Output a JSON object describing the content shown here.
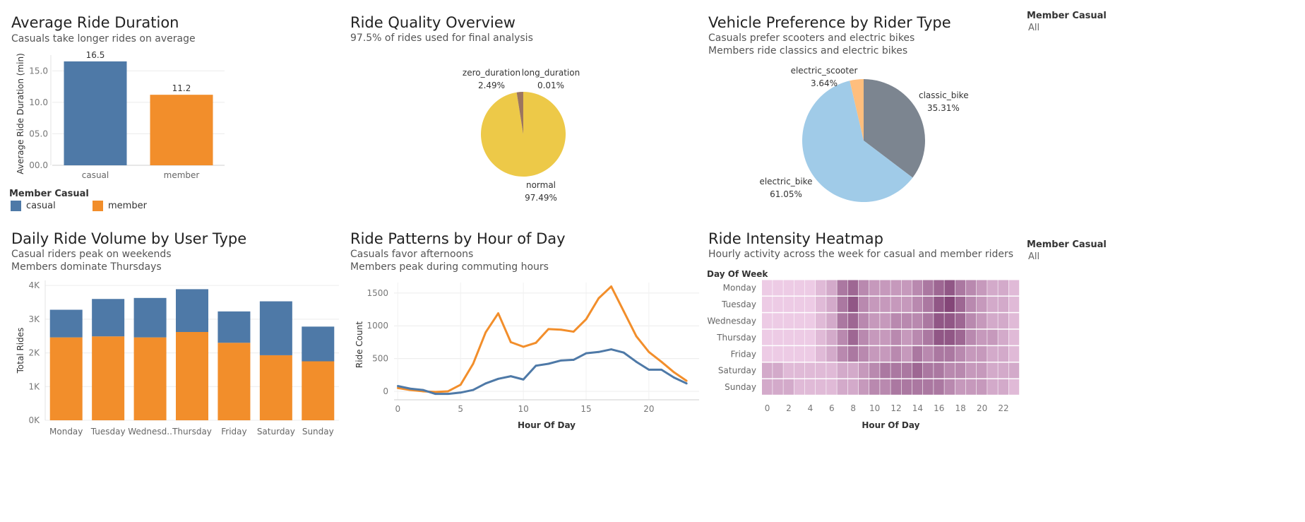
{
  "filters": [
    {
      "title": "Member Casual",
      "value": "All"
    },
    {
      "title": "Member Casual",
      "value": "All"
    }
  ],
  "panels": {
    "avg_duration": {
      "title": "Average Ride Duration",
      "subtitle": "Casuals take longer rides on average"
    },
    "ride_quality": {
      "title": "Ride Quality Overview",
      "subtitle": "97.5% of rides used for final analysis"
    },
    "vehicle_pref": {
      "title": "Vehicle Preference by Rider Type",
      "subtitle_1": "Casuals prefer scooters and electric bikes",
      "subtitle_2": "Members ride classics and electric bikes"
    },
    "daily_volume": {
      "title": "Daily Ride Volume by User Type",
      "subtitle_1": "Casual riders peak on weekends",
      "subtitle_2": "Members dominate Thursdays"
    },
    "hourly": {
      "title": "Ride Patterns by Hour of Day",
      "subtitle_1": "Casuals favor afternoons",
      "subtitle_2": "Members peak during commuting hours"
    },
    "heatmap": {
      "title": "Ride Intensity Heatmap",
      "subtitle": "Hourly activity across the week for casual and member riders"
    }
  },
  "legend": {
    "title": "Member Casual",
    "items": [
      {
        "label": "casual",
        "color": "#4e79a7"
      },
      {
        "label": "member",
        "color": "#f28e2b"
      }
    ]
  },
  "colors": {
    "casual": "#4e79a7",
    "member": "#f28e2b"
  },
  "chart_data": [
    {
      "id": "avg_duration",
      "type": "bar",
      "categories": [
        "casual",
        "member"
      ],
      "values": [
        16.5,
        11.2
      ],
      "value_labels": [
        "16.5",
        "11.2"
      ],
      "ylabel": "Average Ride Duration (min)",
      "yticks": [
        0,
        5,
        10,
        15
      ],
      "ytick_labels": [
        "00.0",
        "05.0",
        "10.0",
        "15.0"
      ],
      "ylim": [
        0,
        17.5
      ],
      "colors": [
        "#4e79a7",
        "#f28e2b"
      ]
    },
    {
      "id": "ride_quality",
      "type": "pie",
      "slices": [
        {
          "label": "normal",
          "pct_label": "97.49%",
          "value": 97.49,
          "color": "#edc948"
        },
        {
          "label": "zero_duration",
          "pct_label": "2.49%",
          "value": 2.49,
          "color": "#9c755f"
        },
        {
          "label": "long_duration",
          "pct_label": "0.01%",
          "value": 0.01,
          "color": "#e15759"
        }
      ]
    },
    {
      "id": "vehicle_pref",
      "type": "pie",
      "slices": [
        {
          "label": "classic_bike",
          "pct_label": "35.31%",
          "value": 35.31,
          "color": "#7c8590"
        },
        {
          "label": "electric_bike",
          "pct_label": "61.05%",
          "value": 61.05,
          "color": "#a0cbe8"
        },
        {
          "label": "electric_scooter",
          "pct_label": "3.64%",
          "value": 3.64,
          "color": "#ffbe7d"
        }
      ]
    },
    {
      "id": "daily_volume",
      "type": "bar",
      "stacked": true,
      "categories": [
        "Monday",
        "Tuesday",
        "Wednesd..",
        "Thursday",
        "Friday",
        "Saturday",
        "Sunday"
      ],
      "series": [
        {
          "name": "member",
          "values": [
            2460,
            2490,
            2460,
            2620,
            2300,
            1930,
            1750
          ]
        },
        {
          "name": "casual",
          "values": [
            820,
            1110,
            1170,
            1270,
            930,
            1600,
            1030
          ]
        }
      ],
      "ylabel": "Total Rides",
      "yticks": [
        0,
        1000,
        2000,
        3000,
        4000
      ],
      "ytick_labels": [
        "0K",
        "1K",
        "2K",
        "3K",
        "4K"
      ],
      "ylim": [
        0,
        4150
      ]
    },
    {
      "id": "hourly",
      "type": "line",
      "x": [
        0,
        1,
        2,
        3,
        4,
        5,
        6,
        7,
        8,
        9,
        10,
        11,
        12,
        13,
        14,
        15,
        16,
        17,
        18,
        19,
        20,
        21,
        22,
        23
      ],
      "series": [
        {
          "name": "member",
          "values": [
            50,
            20,
            0,
            -10,
            0,
            100,
            420,
            900,
            1190,
            750,
            680,
            740,
            950,
            940,
            910,
            1100,
            1420,
            1600,
            1220,
            840,
            600,
            450,
            290,
            160
          ]
        },
        {
          "name": "casual",
          "values": [
            80,
            40,
            20,
            -40,
            -40,
            -20,
            20,
            120,
            190,
            230,
            180,
            390,
            420,
            470,
            480,
            580,
            600,
            640,
            590,
            450,
            330,
            330,
            210,
            120
          ]
        }
      ],
      "xlabel": "Hour Of Day",
      "ylabel": "Ride Count",
      "xticks": [
        0,
        5,
        10,
        15,
        20
      ],
      "yticks": [
        0,
        500,
        1000,
        1500
      ],
      "xlim": [
        -0.3,
        24
      ],
      "ylim": [
        -130,
        1660
      ]
    },
    {
      "id": "heatmap",
      "type": "heatmap",
      "row_header": "Day Of Week",
      "rows": [
        "Monday",
        "Tuesday",
        "Wednesday",
        "Thursday",
        "Friday",
        "Saturday",
        "Sunday"
      ],
      "columns": [
        0,
        1,
        2,
        3,
        4,
        5,
        6,
        7,
        8,
        9,
        10,
        11,
        12,
        13,
        14,
        15,
        16,
        17,
        18,
        19,
        20,
        21,
        22,
        23
      ],
      "xticks": [
        0,
        2,
        4,
        6,
        8,
        10,
        12,
        14,
        16,
        18,
        20,
        22
      ],
      "xlabel": "Hour Of Day",
      "values": [
        [
          1,
          1,
          1,
          1,
          1,
          2,
          3,
          6,
          7,
          5,
          4,
          4,
          4,
          4,
          5,
          6,
          7,
          8,
          6,
          5,
          4,
          3,
          3,
          2
        ],
        [
          1,
          1,
          1,
          1,
          1,
          2,
          3,
          6,
          8,
          5,
          4,
          4,
          4,
          4,
          5,
          6,
          8,
          9,
          7,
          5,
          4,
          3,
          3,
          2
        ],
        [
          1,
          1,
          1,
          1,
          1,
          2,
          3,
          6,
          7,
          5,
          4,
          4,
          5,
          5,
          5,
          6,
          8,
          8,
          7,
          5,
          4,
          3,
          3,
          2
        ],
        [
          1,
          1,
          1,
          1,
          1,
          2,
          3,
          5,
          7,
          5,
          4,
          4,
          5,
          4,
          5,
          6,
          8,
          8,
          7,
          5,
          4,
          4,
          3,
          2
        ],
        [
          1,
          1,
          1,
          1,
          1,
          2,
          3,
          5,
          6,
          5,
          4,
          4,
          5,
          4,
          6,
          5,
          6,
          6,
          5,
          4,
          4,
          3,
          3,
          2
        ],
        [
          3,
          3,
          2,
          2,
          2,
          2,
          2,
          3,
          3,
          4,
          5,
          6,
          6,
          6,
          7,
          6,
          6,
          5,
          5,
          4,
          4,
          3,
          3,
          3
        ],
        [
          3,
          3,
          3,
          2,
          2,
          2,
          2,
          3,
          3,
          4,
          5,
          5,
          6,
          6,
          6,
          6,
          6,
          5,
          4,
          4,
          4,
          3,
          3,
          2
        ]
      ]
    }
  ]
}
